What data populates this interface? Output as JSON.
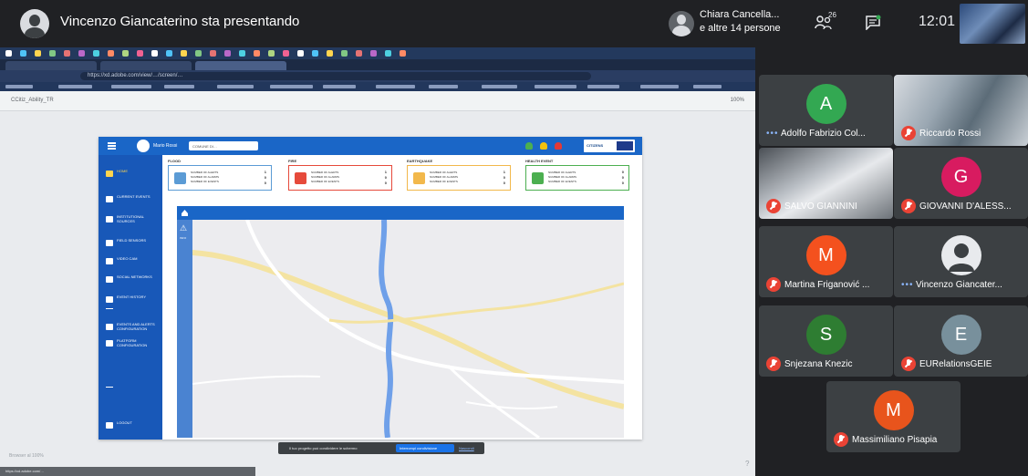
{
  "meeting": {
    "presenter_title": "Vincenzo Giancaterino sta presentando",
    "others_line1": "Chiara Cancella...",
    "others_line2": "e altre 14 persone",
    "people_count": "26",
    "time": "12:01"
  },
  "browser": {
    "address": "https://xd.adobe.com/view/…/screen/…",
    "doc_name": "CCitiz_Ability_TR",
    "doc_tools": "100%"
  },
  "prototype": {
    "user": "Mario Rossi",
    "select_value": "COMUNE DI…",
    "logo_text": "CITIZENS",
    "sidebar": [
      {
        "label": "HOME",
        "icon": "home-icon"
      },
      {
        "label": "CURRENT EVENTS",
        "icon": "calendar-icon"
      },
      {
        "label": "INSTITUTIONAL SOURCES",
        "icon": "building-icon"
      },
      {
        "label": "FIELD SENSORS",
        "icon": "antenna-icon"
      },
      {
        "label": "VIDEO CAM",
        "icon": "camera-icon"
      },
      {
        "label": "SOCIAL NETWORKS",
        "icon": "share-icon"
      },
      {
        "label": "EVENT HISTORY",
        "icon": "history-icon"
      },
      {
        "label": "EVENTS AND ALERTS CONFIGURATION",
        "icon": "settings-icon"
      },
      {
        "label": "PLATFORM CONFIGURATION",
        "icon": "settings-icon"
      },
      {
        "label": "LOGOUT",
        "icon": "logout-icon"
      }
    ],
    "cards": [
      {
        "title": "FLOOD",
        "lines": [
          "NUMBER OF ALERTS",
          "NUMBER OF ALARMS",
          "NUMBER OF EVENTS"
        ],
        "nums": [
          "1",
          "0",
          "0"
        ],
        "color": "#5b9bd5"
      },
      {
        "title": "FIRE",
        "lines": [
          "NUMBER OF ALERTS",
          "NUMBER OF ALARMS",
          "NUMBER OF EVENTS"
        ],
        "nums": [
          "1",
          "0",
          "0"
        ],
        "color": "#e64a3b"
      },
      {
        "title": "EARTHQUAKE",
        "lines": [
          "NUMBER OF ALERTS",
          "NUMBER OF ALARMS",
          "NUMBER OF EVENTS"
        ],
        "nums": [
          "1",
          "0",
          "0"
        ],
        "color": "#f2b84b"
      },
      {
        "title": "HEALTH EVENT",
        "lines": [
          "NUMBER OF ALERTS",
          "NUMBER OF ALARMS",
          "NUMBER OF EVENTS"
        ],
        "nums": [
          "0",
          "0",
          "0"
        ],
        "color": "#4caf50"
      }
    ],
    "map_side_label": "INFO"
  },
  "toast": {
    "text": "Il tuo progetto può condividere le schermo",
    "button": "Interrompi condivisione",
    "link": "Nascondi"
  },
  "bottom_left": "Browser al 100%",
  "status_bar": "https://xd.adobe.com/…",
  "participants": [
    {
      "name": "Adolfo Fabrizio Col...",
      "initial": "A",
      "color": "#33a852",
      "muted": false,
      "video": false
    },
    {
      "name": "Riccardo Rossi",
      "initial": "",
      "color": "#6b7b86",
      "muted": true,
      "video": true
    },
    {
      "name": "SALVO GIANNINI",
      "initial": "",
      "color": "#8a8f94",
      "muted": true,
      "video": true
    },
    {
      "name": "GIOVANNI D'ALESS...",
      "initial": "G",
      "color": "#d81b60",
      "muted": true,
      "video": false
    },
    {
      "name": "Martina Friganović ...",
      "initial": "M",
      "color": "#f4511e",
      "muted": true,
      "video": false
    },
    {
      "name": "Vincenzo Giancater...",
      "initial": "",
      "color": "#e8eaed",
      "muted": false,
      "video": false,
      "avatar": true
    },
    {
      "name": "Snjezana Knezic",
      "initial": "S",
      "color": "#2e7d32",
      "muted": true,
      "video": false
    },
    {
      "name": "EURelationsGEIE",
      "initial": "E",
      "color": "#78909c",
      "muted": true,
      "video": false
    },
    {
      "name": "Massimiliano Pisapia",
      "initial": "M",
      "color": "#e8541c",
      "muted": true,
      "video": false
    }
  ],
  "colors": {
    "meet_bg": "#202124",
    "tile_bg": "#3c4043",
    "proto_blue": "#1a66c7",
    "mic_red": "#ea4335"
  }
}
